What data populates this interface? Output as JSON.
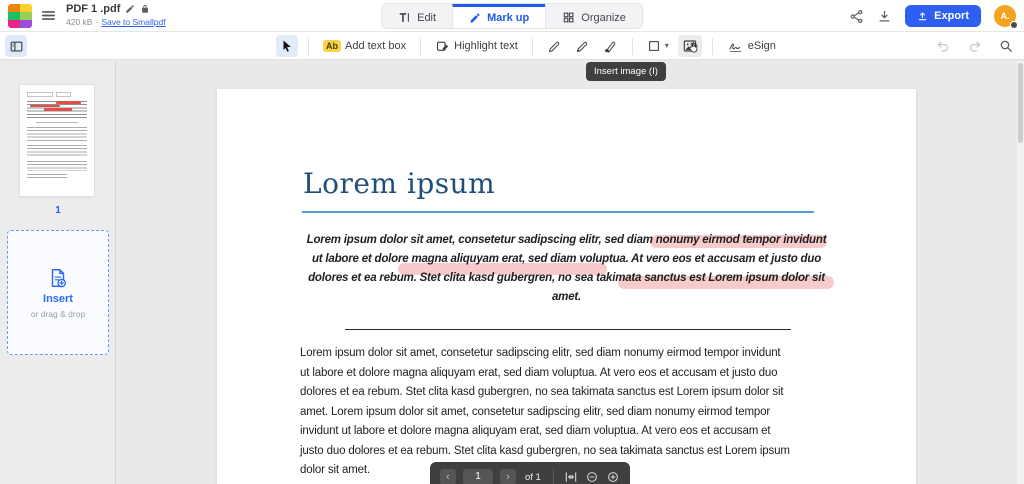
{
  "app": {
    "file_name": "PDF 1 .pdf",
    "file_size": "420 kB",
    "meta_separator": "·",
    "save_link": "Save to Smallpdf",
    "tabs": {
      "edit": "Edit",
      "markup": "Mark up",
      "organize": "Organize"
    },
    "export_label": "Export",
    "avatar_initials": "A."
  },
  "toolbar": {
    "add_text_box_badge": "Ab",
    "add_text_box_label": "Add text box",
    "highlight_text_label": "Highlight text",
    "esign_label": "eSign",
    "insert_image_tooltip": "Insert image (I)"
  },
  "sidebar": {
    "page_number": "1",
    "insert_label": "Insert",
    "insert_hint": "or drag & drop"
  },
  "document": {
    "title": "Lorem ipsum",
    "lead_lines": [
      "Lorem ipsum dolor sit amet, consetetur sadipscing elitr, sed diam nonumy eirmod tempor invidunt",
      "ut labore et dolore magna aliquyam erat, sed diam voluptua. At vero eos et accusam et justo duo",
      "dolores et ea rebum. Stet clita kasd gubergren, no sea takimata sanctus est Lorem ipsum dolor sit",
      "amet."
    ],
    "body_lines": [
      "Lorem ipsum dolor sit amet, consetetur sadipscing elitr, sed diam nonumy eirmod tempor invidunt",
      "ut labore et dolore magna aliquyam erat, sed diam voluptua. At vero eos et accusam et justo duo",
      "dolores et ea rebum. Stet clita kasd gubergren, no sea takimata sanctus est Lorem ipsum dolor sit",
      "amet. Lorem ipsum dolor sit amet, consetetur sadipscing elitr, sed diam nonumy eirmod tempor",
      "invidunt ut labore et dolore magna aliquyam erat, sed diam voluptua. At vero eos et accusam et",
      "justo duo dolores et ea rebum. Stet clita kasd gubergren, no sea takimata sanctus est Lorem ipsum",
      "dolor sit amet."
    ]
  },
  "pager": {
    "page_value": "1",
    "of_label": "of 1"
  },
  "icons": {
    "caret_down": "▾",
    "chevron_left": "‹",
    "chevron_right": "›"
  },
  "colors": {
    "accent_blue": "#1f5ae8",
    "export_blue": "#2e5ff2",
    "avatar_orange": "#f5a31f",
    "title_blue": "#1f4e79",
    "title_rule_blue": "#5b9bd5",
    "highlight_pink": "#f0a0a0",
    "thumb_mark_red": "#e25048",
    "logo_squares": [
      "#f5820b",
      "#fdd02e",
      "#1fc062",
      "#9ccc58",
      "#e9248c",
      "#9c4ddb"
    ]
  }
}
